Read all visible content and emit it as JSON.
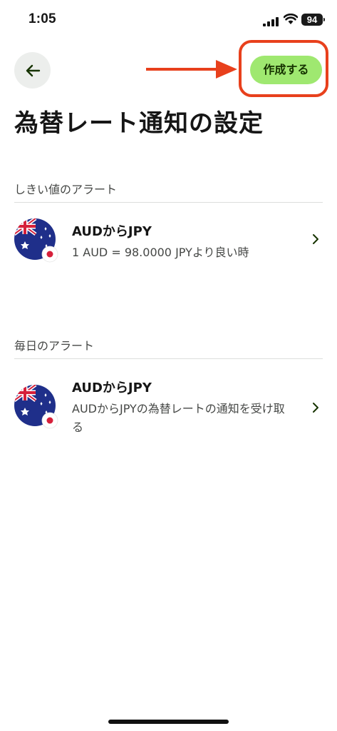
{
  "status_bar": {
    "time": "1:05",
    "battery": "94"
  },
  "header": {
    "back_icon": "arrow-left-icon",
    "create_label": "作成する",
    "annotation_color": "#e8401c",
    "accent_color": "#9fe870"
  },
  "page": {
    "title": "為替レート通知の設定"
  },
  "sections": [
    {
      "heading": "しきい値のアラート",
      "item": {
        "title": "AUDからJPY",
        "subtitle": "1 AUD = 98.0000 JPYより良い時",
        "flag": "australia-flag-with-japan-badge"
      }
    },
    {
      "heading": "毎日のアラート",
      "item": {
        "title": "AUDからJPY",
        "subtitle": "AUDからJPYの為替レートの通知を受け取る",
        "flag": "australia-flag-with-japan-badge"
      }
    }
  ]
}
